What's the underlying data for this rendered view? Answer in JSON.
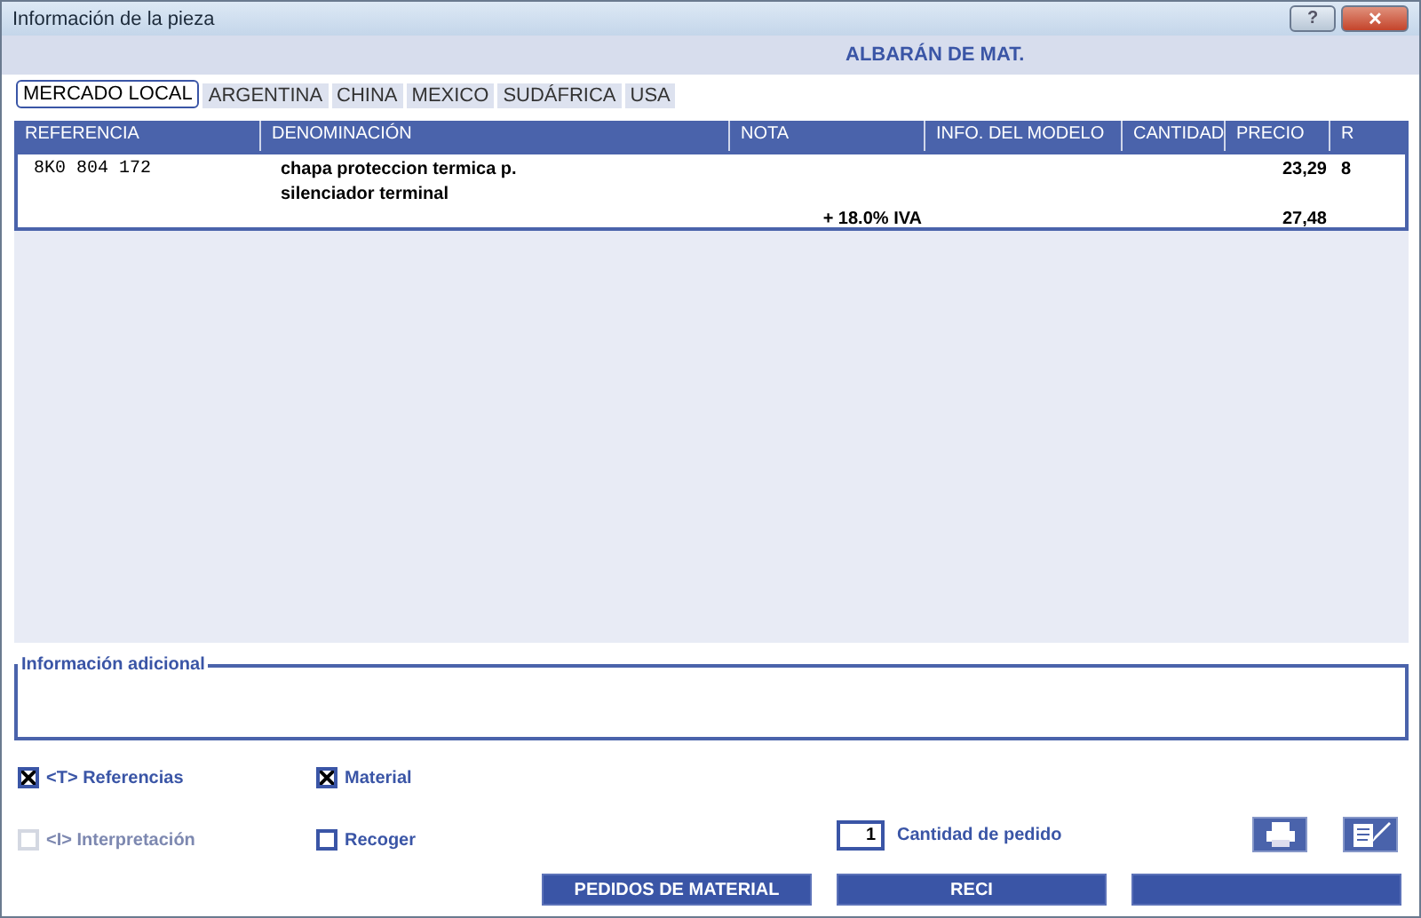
{
  "window": {
    "title": "Información de la pieza",
    "buttons": [
      {
        "kind": "help",
        "label": "?"
      },
      {
        "kind": "close",
        "label": "✕"
      }
    ]
  },
  "header": {
    "title": "ALBARÁN DE MAT."
  },
  "tabs": [
    {
      "label": "MERCADO LOCAL",
      "selected": true
    },
    {
      "label": "ARGENTINA",
      "selected": false
    },
    {
      "label": "CHINA",
      "selected": false
    },
    {
      "label": "MEXICO",
      "selected": false
    },
    {
      "label": "SUDÁFRICA",
      "selected": false
    },
    {
      "label": "USA",
      "selected": false
    }
  ],
  "table": {
    "columns": [
      "REFERENCIA",
      "DENOMINACIÓN",
      "NOTA",
      "INFO. DEL MODELO",
      "CANTIDAD",
      "PRECIO",
      "R"
    ],
    "rows": [
      {
        "cells": [
          "8K0 804 172",
          "chapa proteccion termica p.",
          "",
          "",
          "",
          "23,29",
          "8"
        ]
      },
      {
        "cells": [
          "",
          "silenciador terminal",
          "",
          "",
          "",
          "",
          ""
        ]
      },
      {
        "cells": [
          "",
          "",
          "+ 18.0% IVA",
          "",
          "",
          "27,48",
          ""
        ]
      }
    ]
  },
  "additional_info": {
    "label": "Información adicional"
  },
  "checkboxes": [
    {
      "label": "<T> Referencias",
      "checked": true,
      "disabled": false
    },
    {
      "label": "Material",
      "checked": true,
      "disabled": false
    },
    {
      "label": "<I> Interpretación",
      "checked": false,
      "disabled": true
    },
    {
      "label": "Recoger",
      "checked": false,
      "disabled": false
    }
  ],
  "quantity": {
    "value": "1",
    "label": "Cantidad de pedido"
  },
  "icon_buttons": [
    {
      "kind": "print"
    },
    {
      "kind": "edit"
    }
  ],
  "buttons": [
    {
      "kind": "text",
      "label": "PEDIDOS DE MATERIAL"
    },
    {
      "kind": "text",
      "label": "RECI"
    },
    {
      "kind": "blank"
    }
  ]
}
